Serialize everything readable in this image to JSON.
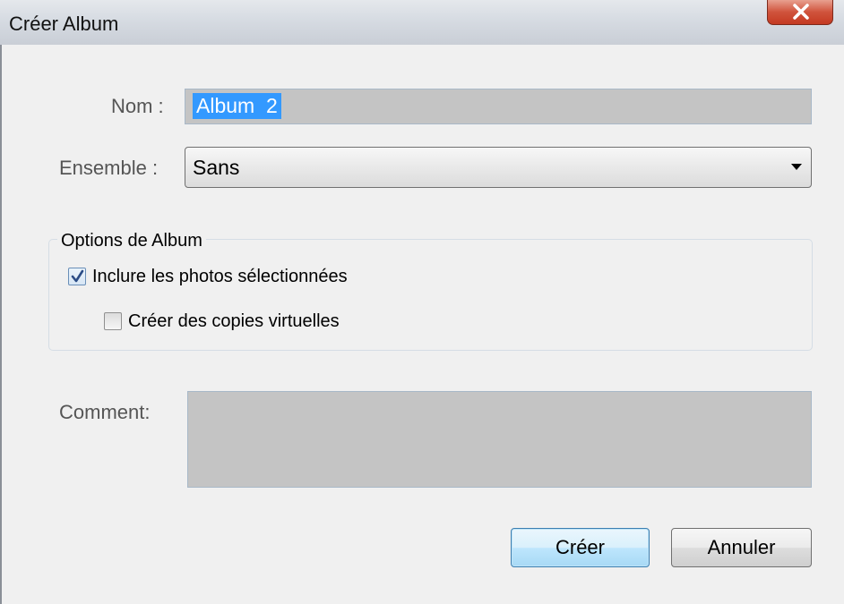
{
  "window": {
    "title": "Créer Album",
    "close_icon": "close-icon"
  },
  "form": {
    "name_label": "Nom :",
    "name_value": "Album  2",
    "set_label": "Ensemble :",
    "set_value": "Sans",
    "options_legend": "Options de Album",
    "include_label": "Inclure les photos sélectionnées",
    "include_checked": true,
    "virtual_label": "Créer des copies virtuelles",
    "virtual_checked": false,
    "comment_label": "Comment:",
    "comment_value": ""
  },
  "buttons": {
    "create_label": "Créer",
    "cancel_label": "Annuler"
  },
  "colors": {
    "selection": "#3399ff",
    "close_button": "#c9452d",
    "input_background": "#c4c4c4"
  }
}
